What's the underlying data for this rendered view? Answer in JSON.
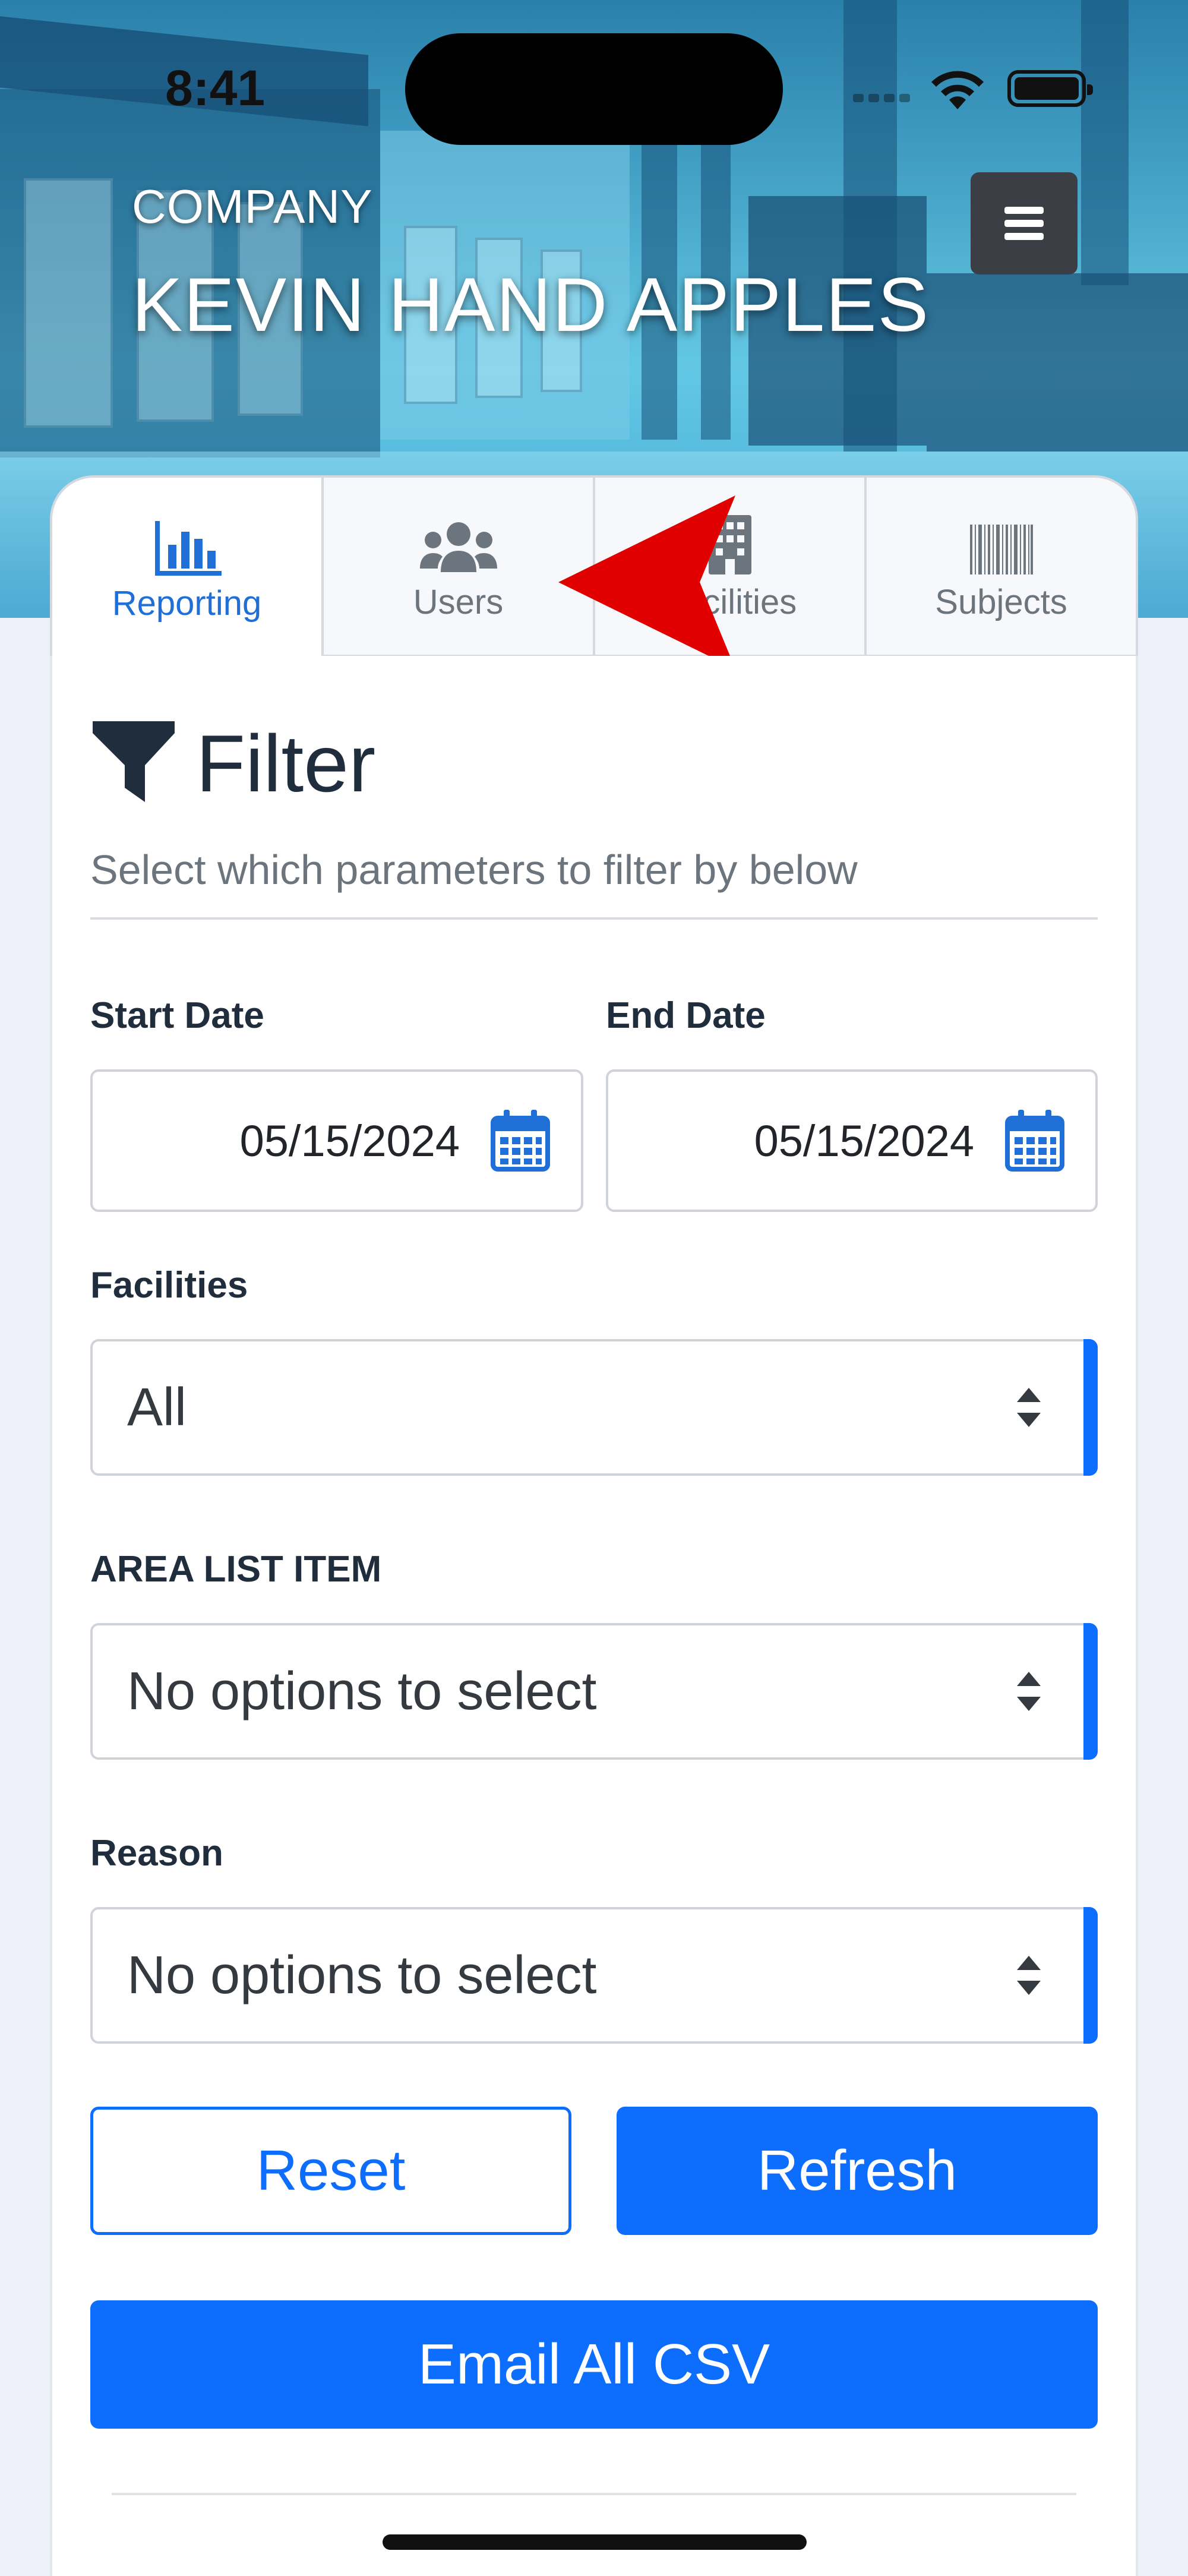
{
  "status_bar": {
    "time": "8:41"
  },
  "header": {
    "company_label": "COMPANY",
    "company_name": "KEVIN HAND APPLES",
    "menu_icon": "hamburger-menu-icon"
  },
  "tabs": [
    {
      "label": "Reporting",
      "icon": "bar-chart-icon",
      "active": true
    },
    {
      "label": "Users",
      "icon": "users-icon",
      "active": false
    },
    {
      "label": "Facilities",
      "icon": "building-icon",
      "active": false
    },
    {
      "label": "Subjects",
      "icon": "barcode-icon",
      "active": false
    }
  ],
  "filter": {
    "title": "Filter",
    "subtitle": "Select which parameters to filter by below",
    "start_date": {
      "label": "Start Date",
      "value": "05/15/2024"
    },
    "end_date": {
      "label": "End Date",
      "value": "05/15/2024"
    },
    "facilities": {
      "label": "Facilities",
      "value": "All"
    },
    "area_list_item": {
      "label": "AREA LIST ITEM",
      "value": "No options to select"
    },
    "reason": {
      "label": "Reason",
      "value": "No options to select"
    }
  },
  "buttons": {
    "reset": "Reset",
    "refresh": "Refresh",
    "email_all_csv": "Email All CSV"
  },
  "colors": {
    "primary": "#0d6efd",
    "annotation_arrow": "#e00000"
  }
}
